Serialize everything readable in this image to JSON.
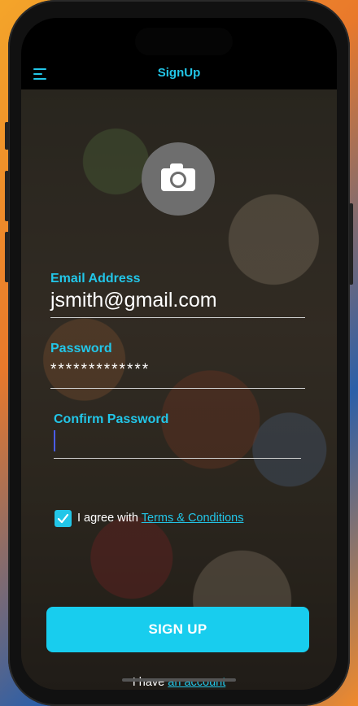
{
  "header": {
    "title": "SignUp",
    "menu_icon": "hamburger-menu-icon"
  },
  "avatar": {
    "icon": "camera-icon"
  },
  "form": {
    "email": {
      "label": "Email Address",
      "value": "jsmith@gmail.com"
    },
    "password": {
      "label": "Password",
      "value": "*************"
    },
    "confirm_password": {
      "label": "Confirm Password",
      "value": ""
    }
  },
  "terms": {
    "checked": true,
    "prefix": "I agree with",
    "link_text": "Terms & Conditions"
  },
  "signup_button": {
    "label": "SIGN UP"
  },
  "footer": {
    "prefix": "I have",
    "link_text": "an account"
  },
  "colors": {
    "accent": "#22c6e8",
    "button": "#18cdee",
    "caret": "#4a5cf0"
  }
}
